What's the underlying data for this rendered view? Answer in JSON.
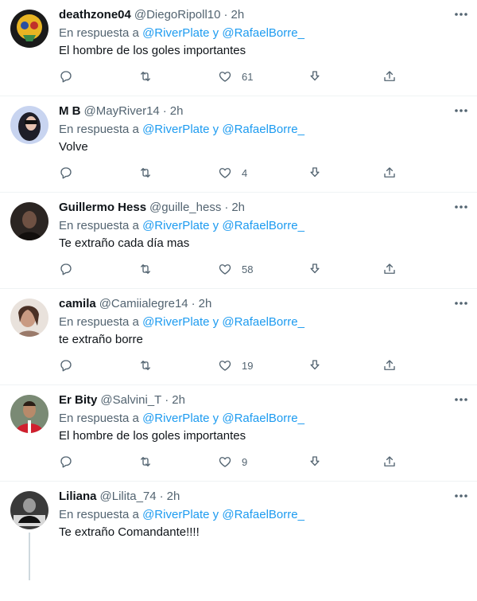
{
  "reply_prefix": "En respuesta a",
  "mention_1": "@RiverPlate",
  "connector": "y",
  "mention_2": "@RafaelBorre_",
  "separator": "·",
  "tweets": [
    {
      "name": "deathzone04",
      "handle": "@DiegoRipoll10",
      "time": "2h",
      "text": "El hombre de los goles importantes",
      "likes": "61"
    },
    {
      "name": "M B",
      "handle": "@MayRiver14",
      "time": "2h",
      "text": "Volve",
      "likes": "4"
    },
    {
      "name": "Guillermo Hess",
      "handle": "@guille_hess",
      "time": "2h",
      "text": "Te extraño cada día mas",
      "likes": "58"
    },
    {
      "name": "camila",
      "handle": "@Camiialegre14",
      "time": "2h",
      "text": "te extraño borre",
      "likes": "19"
    },
    {
      "name": "Er Bity",
      "handle": "@Salvini_T",
      "time": "2h",
      "text": "El hombre de los goles importantes",
      "likes": "9"
    },
    {
      "name": "Liliana",
      "handle": "@Lilita_74",
      "time": "2h",
      "text": "Te extraño Comandante!!!!",
      "likes": ""
    }
  ]
}
